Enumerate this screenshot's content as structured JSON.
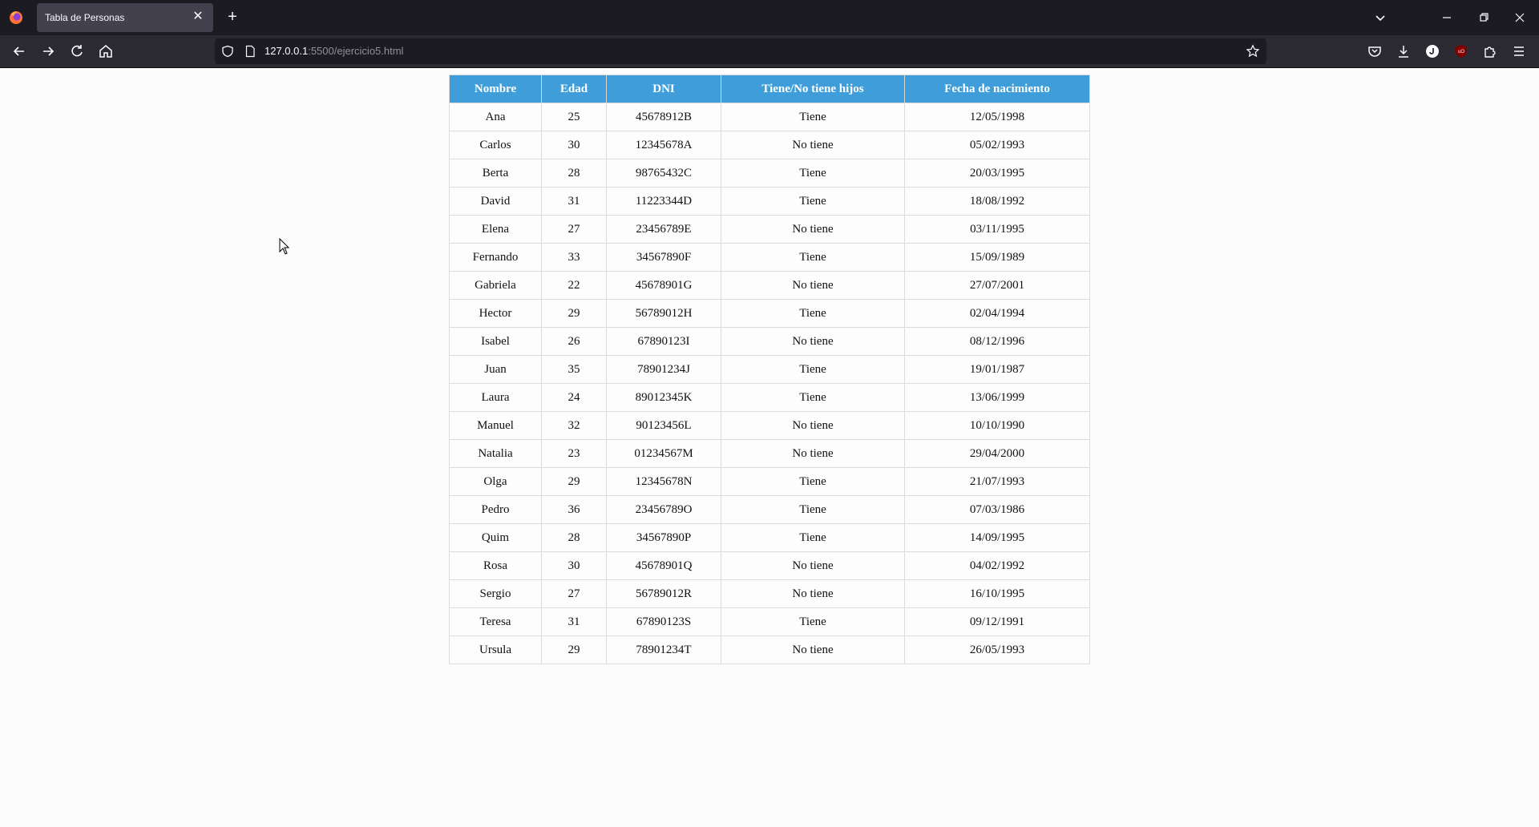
{
  "browser": {
    "tab_title": "Tabla de Personas",
    "url_host": "127.0.0.1",
    "url_path": ":5500/ejercicio5.html"
  },
  "table": {
    "headers": [
      "Nombre",
      "Edad",
      "DNI",
      "Tiene/No tiene hijos",
      "Fecha de nacimiento"
    ],
    "rows": [
      [
        "Ana",
        "25",
        "45678912B",
        "Tiene",
        "12/05/1998"
      ],
      [
        "Carlos",
        "30",
        "12345678A",
        "No tiene",
        "05/02/1993"
      ],
      [
        "Berta",
        "28",
        "98765432C",
        "Tiene",
        "20/03/1995"
      ],
      [
        "David",
        "31",
        "11223344D",
        "Tiene",
        "18/08/1992"
      ],
      [
        "Elena",
        "27",
        "23456789E",
        "No tiene",
        "03/11/1995"
      ],
      [
        "Fernando",
        "33",
        "34567890F",
        "Tiene",
        "15/09/1989"
      ],
      [
        "Gabriela",
        "22",
        "45678901G",
        "No tiene",
        "27/07/2001"
      ],
      [
        "Hector",
        "29",
        "56789012H",
        "Tiene",
        "02/04/1994"
      ],
      [
        "Isabel",
        "26",
        "67890123I",
        "No tiene",
        "08/12/1996"
      ],
      [
        "Juan",
        "35",
        "78901234J",
        "Tiene",
        "19/01/1987"
      ],
      [
        "Laura",
        "24",
        "89012345K",
        "Tiene",
        "13/06/1999"
      ],
      [
        "Manuel",
        "32",
        "90123456L",
        "No tiene",
        "10/10/1990"
      ],
      [
        "Natalia",
        "23",
        "01234567M",
        "No tiene",
        "29/04/2000"
      ],
      [
        "Olga",
        "29",
        "12345678N",
        "Tiene",
        "21/07/1993"
      ],
      [
        "Pedro",
        "36",
        "23456789O",
        "Tiene",
        "07/03/1986"
      ],
      [
        "Quim",
        "28",
        "34567890P",
        "Tiene",
        "14/09/1995"
      ],
      [
        "Rosa",
        "30",
        "45678901Q",
        "No tiene",
        "04/02/1992"
      ],
      [
        "Sergio",
        "27",
        "56789012R",
        "No tiene",
        "16/10/1995"
      ],
      [
        "Teresa",
        "31",
        "67890123S",
        "Tiene",
        "09/12/1991"
      ],
      [
        "Ursula",
        "29",
        "78901234T",
        "No tiene",
        "26/05/1993"
      ]
    ]
  },
  "colors": {
    "header_bg": "#3f9ed9",
    "tabstrip_bg": "#1c1b22",
    "navbar_bg": "#2b2a33"
  }
}
